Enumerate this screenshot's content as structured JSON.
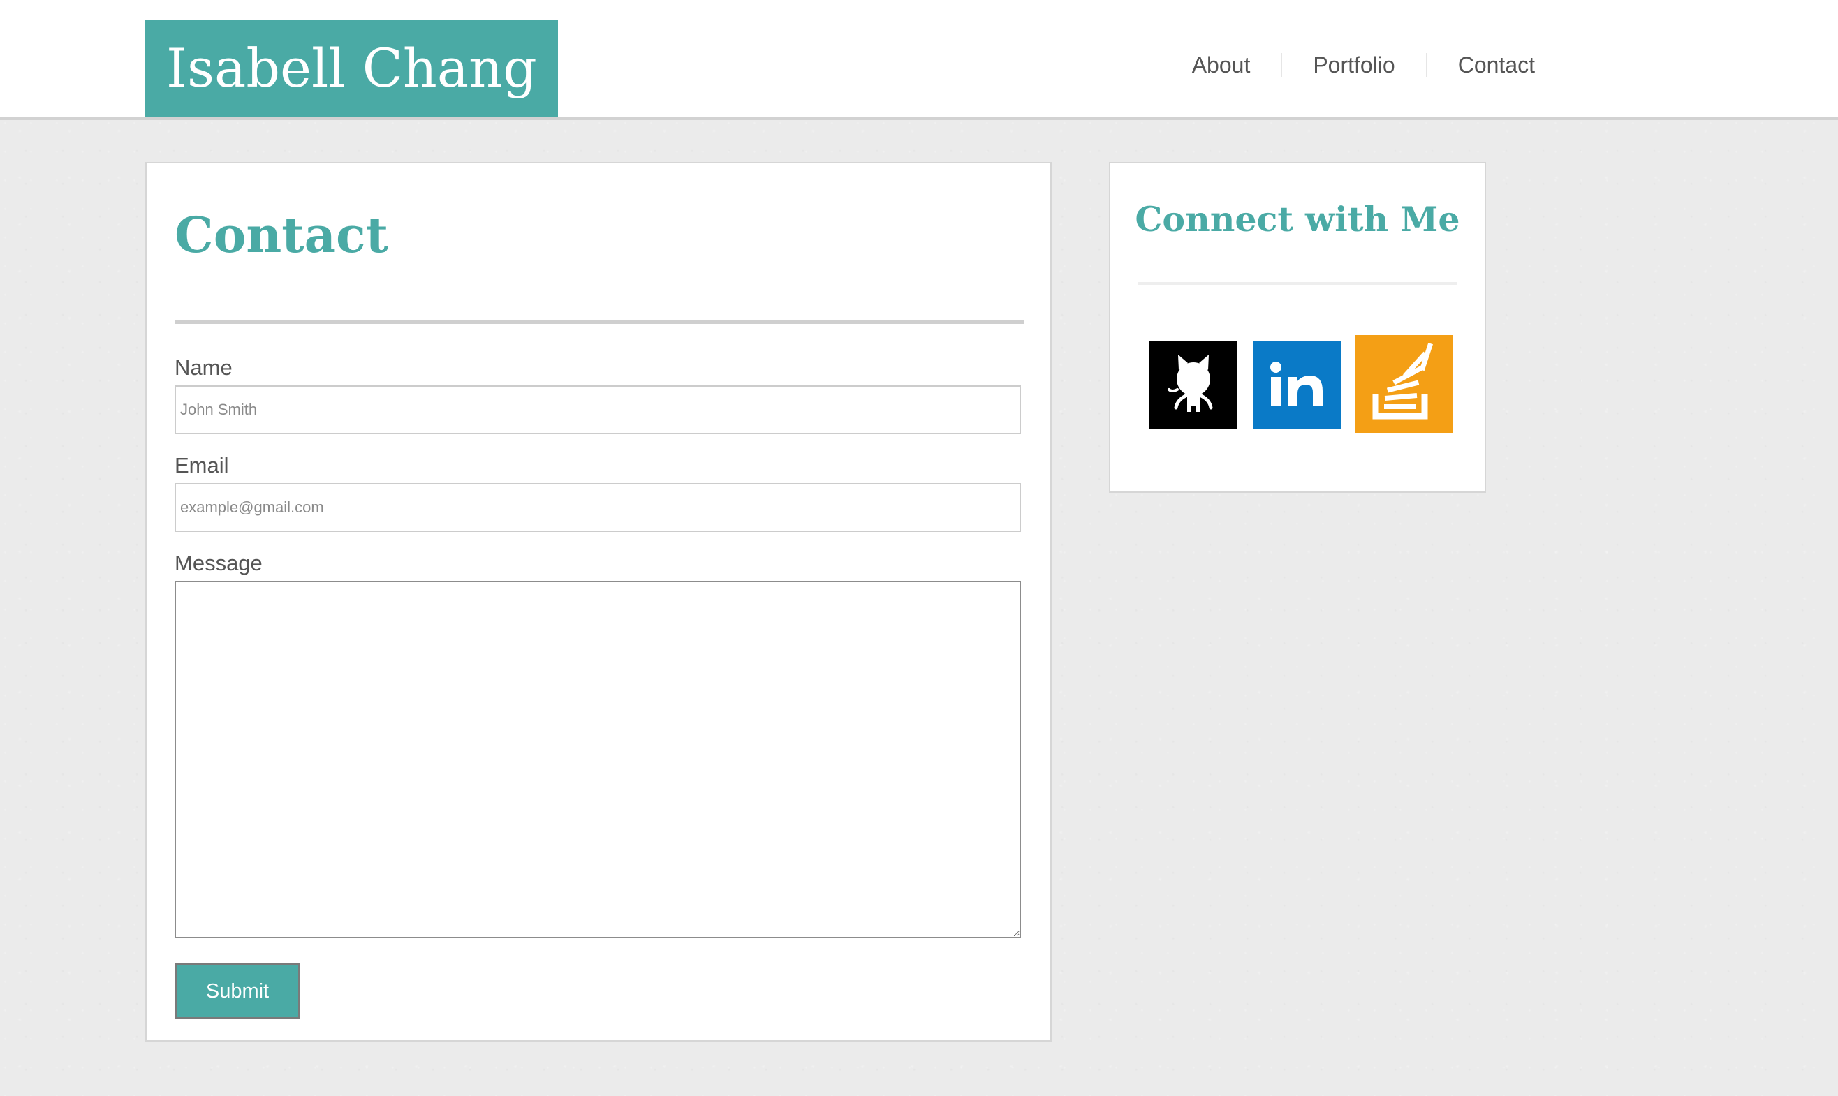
{
  "header": {
    "brand": "Isabell Chang",
    "nav": [
      {
        "label": "About"
      },
      {
        "label": "Portfolio"
      },
      {
        "label": "Contact"
      }
    ]
  },
  "contact": {
    "title": "Contact",
    "fields": {
      "name": {
        "label": "Name",
        "placeholder": "John Smith",
        "value": ""
      },
      "email": {
        "label": "Email",
        "placeholder": "example@gmail.com",
        "value": ""
      },
      "message": {
        "label": "Message",
        "value": ""
      }
    },
    "submit_label": "Submit"
  },
  "connect": {
    "title": "Connect with Me",
    "links": [
      {
        "icon": "github-icon",
        "color": "#000000"
      },
      {
        "icon": "linkedin-icon",
        "color": "#0a7ac7"
      },
      {
        "icon": "stackoverflow-icon",
        "color": "#f49f15"
      }
    ]
  },
  "colors": {
    "accent": "#4aaaa5",
    "background": "#ebebeb",
    "panel": "#ffffff"
  }
}
